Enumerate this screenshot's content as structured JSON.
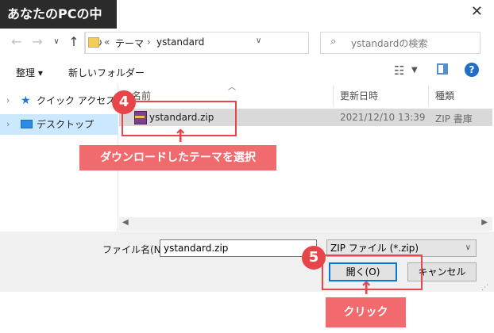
{
  "title_badge": "あなたのPCの中",
  "address": {
    "chevrons": "«",
    "crumbs": [
      "テーマ",
      "ystandard"
    ],
    "separator": "›"
  },
  "search": {
    "placeholder": "ystandardの検索"
  },
  "toolbar": {
    "organize": "整理 ▾",
    "new_folder": "新しいフォルダー"
  },
  "sidebar": {
    "items": [
      {
        "label": "クイック アクセス"
      },
      {
        "label": "デスクトップ"
      }
    ]
  },
  "columns": {
    "name": "名前",
    "date": "更新日時",
    "type": "種類"
  },
  "files": [
    {
      "name": "ystandard.zip",
      "date": "2021/12/10 13:39",
      "type": "ZIP 書庫"
    }
  ],
  "footer": {
    "filename_label": "ファイル名(N):",
    "filename_value": "ystandard.zip",
    "filetype": "ZIP ファイル (*.zip)",
    "open": "開く(O)",
    "cancel": "キャンセル"
  },
  "annotations": {
    "step4": {
      "number": "4",
      "text": "ダウンロードしたテーマを選択"
    },
    "step5": {
      "number": "5",
      "text": "クリック"
    }
  },
  "colors": {
    "accent_red": "#e8454a",
    "callout_red": "#f06a6e",
    "selection": "#cce8ff",
    "primary_border": "#0078d7"
  }
}
